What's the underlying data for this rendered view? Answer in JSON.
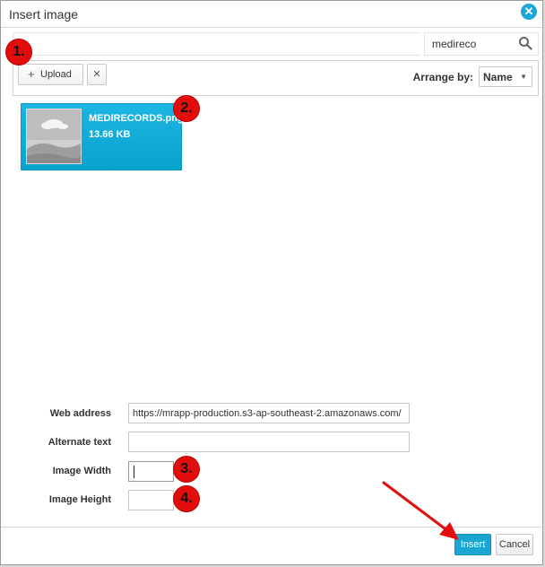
{
  "dialog": {
    "title": "Insert image",
    "close_icon": "close-icon"
  },
  "search": {
    "value": "medireco",
    "icon": "search-icon"
  },
  "toolbar": {
    "upload_label": "Upload",
    "upload_icon": "plus-icon",
    "clear_label": "✕",
    "arrange_label": "Arrange by:",
    "arrange_value": "Name"
  },
  "file": {
    "name": "MEDIRECORDS.png",
    "size": "13.66 KB"
  },
  "form": {
    "web_address_label": "Web address",
    "web_address_value": "https://mrapp-production.s3-ap-southeast-2.amazonaws.com/",
    "alt_text_label": "Alternate text",
    "alt_text_value": "",
    "width_label": "Image Width",
    "width_value": "",
    "height_label": "Image Height",
    "height_value": ""
  },
  "footer": {
    "insert_label": "Insert",
    "cancel_label": "Cancel"
  },
  "annotations": {
    "step1": "1.",
    "step2": "2.",
    "step3": "3.",
    "step4": "4.",
    "color": "#e30d0d"
  },
  "colors": {
    "accent": "#1ba5d2",
    "selected_item": "#08a3cf"
  }
}
